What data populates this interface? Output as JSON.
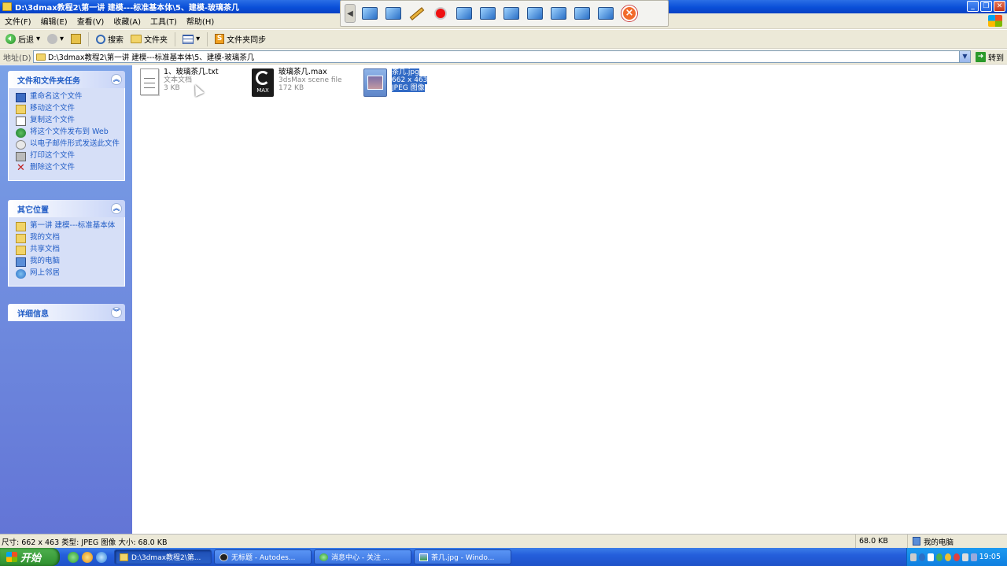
{
  "window": {
    "title": "D:\\3dmax教程2\\第一讲 建模---标准基本体\\5、建模-玻璃茶几",
    "buttons": {
      "minimize": "_",
      "maximize": "❐",
      "close": "✕"
    }
  },
  "menu": [
    "文件(F)",
    "编辑(E)",
    "查看(V)",
    "收藏(A)",
    "工具(T)",
    "帮助(H)"
  ],
  "toolbar": {
    "back": "后退",
    "search": "搜索",
    "folders": "文件夹",
    "sync": "文件夹同步"
  },
  "address": {
    "label": "地址(D)",
    "path": "D:\\3dmax教程2\\第一讲 建模---标准基本体\\5、建模-玻璃茶几",
    "go": "转到"
  },
  "tasks_panel": {
    "title": "文件和文件夹任务",
    "items": [
      "重命名这个文件",
      "移动这个文件",
      "复制这个文件",
      "将这个文件发布到 Web",
      "以电子邮件形式发送此文件",
      "打印这个文件",
      "删除这个文件"
    ]
  },
  "places_panel": {
    "title": "其它位置",
    "items": [
      "第一讲 建模---标准基本体",
      "我的文档",
      "共享文档",
      "我的电脑",
      "网上邻居"
    ]
  },
  "details_panel": {
    "title": "详细信息"
  },
  "files": [
    {
      "name": "1、玻璃茶几.txt",
      "type": "文本文档",
      "size": "3 KB"
    },
    {
      "name": "玻璃茶几.max",
      "type": "3dsMax scene file",
      "size": "172 KB",
      "icon_label": "MAX"
    },
    {
      "name": "茶几.jpg",
      "type": "662 x 463",
      "size": "JPEG 图像"
    }
  ],
  "status": {
    "info": "尺寸: 662 x 463 类型: JPEG 图像 大小: 68.0 KB",
    "size": "68.0 KB",
    "zone": "我的电脑"
  },
  "taskbar": {
    "start": "开始",
    "tasks": [
      "D:\\3dmax教程2\\第...",
      "无标题 - Autodes...",
      "消息中心 - 关注 ...",
      "茶几.jpg - Windo..."
    ],
    "clock": "19:05"
  }
}
